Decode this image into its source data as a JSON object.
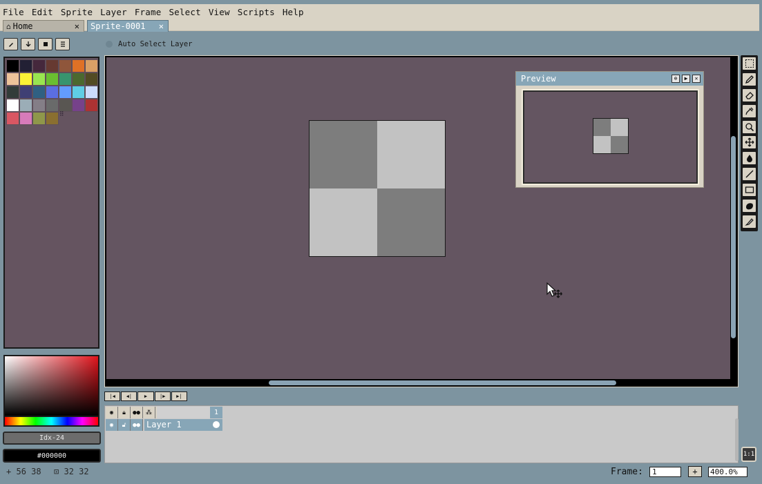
{
  "menu": [
    "File",
    "Edit",
    "Sprite",
    "Layer",
    "Frame",
    "Select",
    "View",
    "Scripts",
    "Help"
  ],
  "tabs": [
    {
      "label": "Home",
      "icon": "home-icon",
      "close": "✕"
    },
    {
      "label": "Sprite-0001",
      "close": "✕",
      "active": true
    }
  ],
  "toolbar": {
    "auto_select_label": "Auto Select Layer"
  },
  "palette": {
    "colors": [
      "#000000",
      "#222034",
      "#45283c",
      "#663931",
      "#8f563b",
      "#df7126",
      "#d9a066",
      "#eec39a",
      "#fbf236",
      "#99e550",
      "#6abe30",
      "#37946e",
      "#4b692f",
      "#524b24",
      "#323c39",
      "#3f3f74",
      "#306082",
      "#5b6ee1",
      "#639bff",
      "#5fcde4",
      "#cbdbfc",
      "#ffffff",
      "#9badb7",
      "#847e87",
      "#696a6a",
      "#595652",
      "#76428a",
      "#ac3232",
      "#d95763",
      "#d77bba",
      "#8f974a",
      "#8a6f30"
    ],
    "handle": "⠿"
  },
  "color_info": {
    "index": "Idx-24",
    "hex": "#000000"
  },
  "preview": {
    "title": "Preview"
  },
  "timeline": {
    "layer_name": "Layer 1",
    "frame_number": "1"
  },
  "status": {
    "position": "56 38",
    "size": "32 32",
    "frame_label": "Frame:",
    "frame_value": "1",
    "plus": "+",
    "zoom": "400.0%",
    "onion": "1:1"
  },
  "colors": {
    "canvas_bg": "#645561",
    "accent": "#87a6b7",
    "chrome": "#d9d3c5",
    "workspace": "#7d94a0",
    "sprite_dark": "#7d7d7d",
    "sprite_light": "#c2c2c2"
  }
}
